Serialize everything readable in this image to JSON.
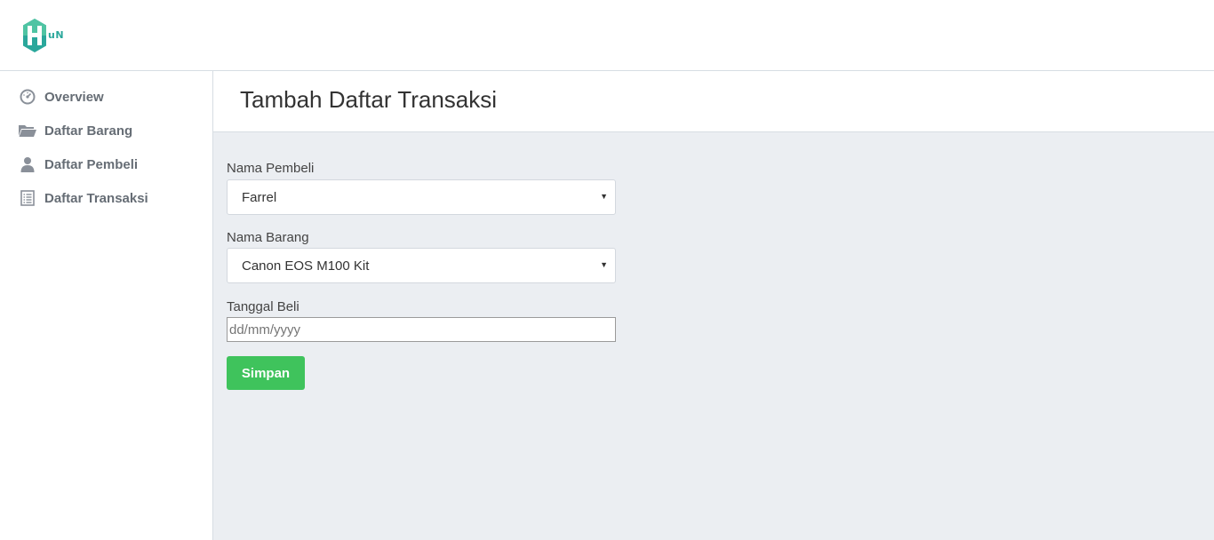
{
  "brand": {
    "logo_letter": "H",
    "logo_text": "uN",
    "color": "#2aa79b"
  },
  "sidebar": {
    "items": [
      {
        "label": "Overview",
        "icon": "dashboard-gauge-icon"
      },
      {
        "label": "Daftar Barang",
        "icon": "folder-open-icon"
      },
      {
        "label": "Daftar Pembeli",
        "icon": "user-icon"
      },
      {
        "label": "Daftar Transaksi",
        "icon": "list-document-icon"
      }
    ]
  },
  "page": {
    "title": "Tambah Daftar Transaksi"
  },
  "form": {
    "buyer": {
      "label": "Nama Pembeli",
      "value": "Farrel"
    },
    "item": {
      "label": "Nama Barang",
      "value": "Canon EOS M100 Kit"
    },
    "date": {
      "label": "Tanggal Beli",
      "placeholder": "dd/mm/yyyy"
    },
    "submit_label": "Simpan"
  },
  "colors": {
    "accent_green": "#3fc35c",
    "content_bg": "#ebeef2",
    "nav_text": "#666d75"
  }
}
